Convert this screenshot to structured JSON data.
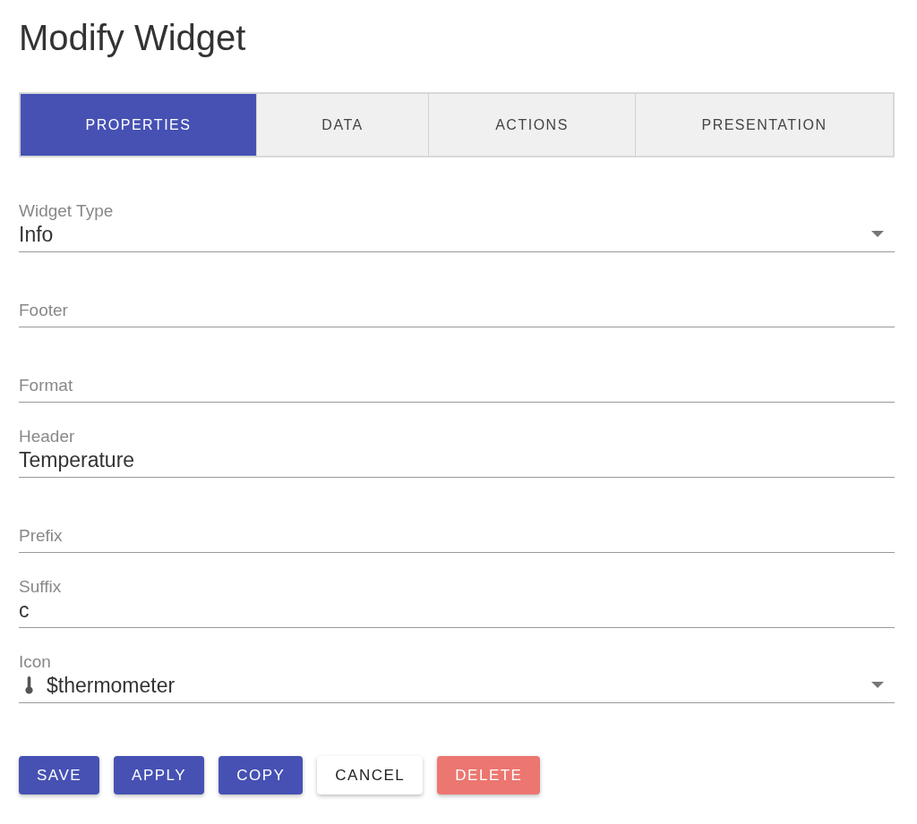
{
  "title": "Modify Widget",
  "tabs": [
    {
      "label": "PROPERTIES",
      "selected": true
    },
    {
      "label": "DATA",
      "selected": false
    },
    {
      "label": "ACTIONS",
      "selected": false
    },
    {
      "label": "PRESENTATION",
      "selected": false
    }
  ],
  "fields": [
    {
      "kind": "select",
      "label": "Widget Type",
      "value": "Info"
    },
    {
      "kind": "text",
      "label": "Footer"
    },
    {
      "kind": "text",
      "label": "Format"
    },
    {
      "kind": "text",
      "label": "Header",
      "value": "Temperature"
    },
    {
      "kind": "text",
      "label": "Prefix"
    },
    {
      "kind": "text",
      "label": "Suffix",
      "value": "c"
    },
    {
      "kind": "icon-select",
      "label": "Icon",
      "value": "$thermometer"
    }
  ],
  "buttons": [
    {
      "label": "SAVE",
      "kind": "primary"
    },
    {
      "label": "APPLY",
      "kind": "primary"
    },
    {
      "label": "COPY",
      "kind": "primary"
    },
    {
      "label": "CANCEL",
      "kind": "plain"
    },
    {
      "label": "DELETE",
      "kind": "danger"
    }
  ]
}
